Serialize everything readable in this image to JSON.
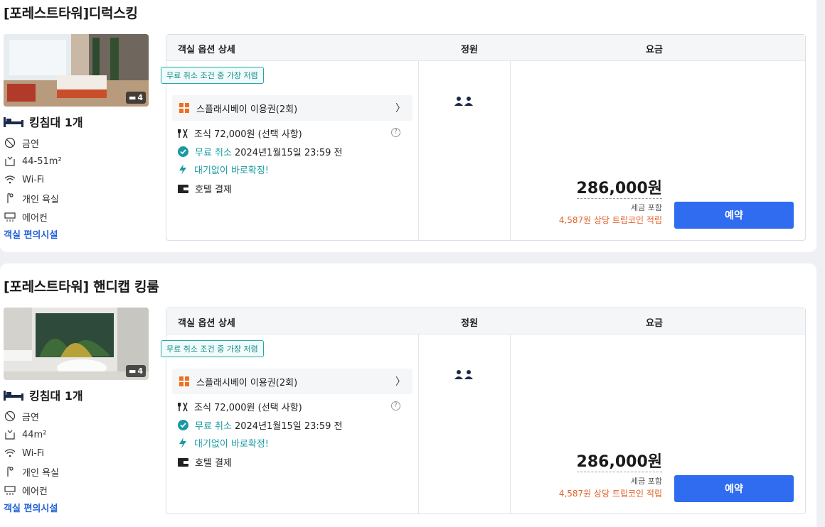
{
  "rooms": [
    {
      "title": "[포레스트타워]디럭스킹",
      "photo_count": "4",
      "bed": "킹침대 1개",
      "amenities": [
        "금연",
        "44-51m²",
        "Wi-Fi",
        "개인 욕실",
        "에어컨"
      ],
      "amenities_link": "객실 편의시설",
      "table_headers": {
        "detail": "객실 옵션 상세",
        "capacity": "정원",
        "price": "요금"
      },
      "tag": "무료 취소 조건 중 가장 저렴",
      "package": "스플래시베이 이용권(2회)",
      "options": {
        "breakfast": "조식 72,000원 (선택 사항)",
        "cancel_prefix": "무료 취소",
        "cancel_deadline": "2024년1월15일 23:59 전",
        "instant": "대기없이 바로확정!",
        "payment": "호텔 결제"
      },
      "price": "286,000원",
      "tax_note": "세금 포함",
      "coin_note": "4,587원 상당 트립코인 적립",
      "book_label": "예약"
    },
    {
      "title": "[포레스트타워] 핸디캡 킹룸",
      "photo_count": "4",
      "bed": "킹침대 1개",
      "amenities": [
        "금연",
        "44m²",
        "Wi-Fi",
        "개인 욕실",
        "에어컨"
      ],
      "amenities_link": "객실 편의시설",
      "table_headers": {
        "detail": "객실 옵션 상세",
        "capacity": "정원",
        "price": "요금"
      },
      "tag": "무료 취소 조건 중 가장 저렴",
      "package": "스플래시베이 이용권(2회)",
      "options": {
        "breakfast": "조식 72,000원 (선택 사항)",
        "cancel_prefix": "무료 취소",
        "cancel_deadline": "2024년1월15일 23:59 전",
        "instant": "대기없이 바로확정!",
        "payment": "호텔 결제"
      },
      "price": "286,000원",
      "tax_note": "세금 포함",
      "coin_note": "4,587원 상당 트립코인 적립",
      "book_label": "예약"
    }
  ],
  "colors": {
    "accent": "#2f6cf0",
    "teal": "#1a9aa0",
    "coin": "#e0622a",
    "link": "#1f5fd6"
  }
}
